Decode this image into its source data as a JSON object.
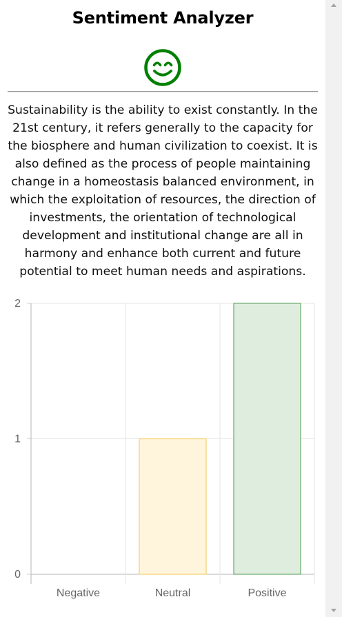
{
  "app": {
    "title": "Sentiment Analyzer"
  },
  "sentiment_icon": {
    "name": "smiling-face-icon",
    "color": "#008000"
  },
  "analyzed_text": "Sustainability is the ability to exist constantly. In the 21st century, it refers generally to the capacity for the biosphere and human civilization to coexist. It is also defined as the process of people maintaining change in a homeostasis balanced environment, in which the exploitation of resources, the direction of investments, the orientation of technological development and institutional change are all in harmony and enhance both current and future potential to meet human needs and aspirations.",
  "chart_data": {
    "type": "bar",
    "categories": [
      "Negative",
      "Neutral",
      "Positive"
    ],
    "values": [
      0,
      1,
      2
    ],
    "ylim": [
      0,
      2
    ],
    "yticks": [
      "0",
      "1",
      "2"
    ],
    "grid": true,
    "legend": "none",
    "colors": {
      "Negative": {
        "fill": "#f9d6d6",
        "stroke": "#e57373"
      },
      "Neutral": {
        "fill": "#fff4dc",
        "stroke": "#f3cf6b"
      },
      "Positive": {
        "fill": "#dfeddf",
        "stroke": "#6aaa6a"
      }
    }
  }
}
